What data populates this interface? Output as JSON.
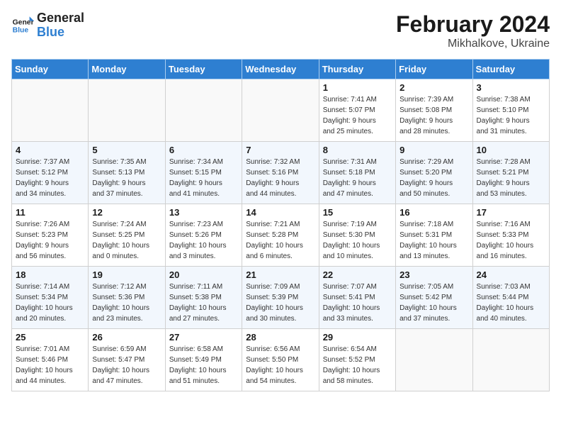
{
  "header": {
    "logo_line1": "General",
    "logo_line2": "Blue",
    "month_title": "February 2024",
    "subtitle": "Mikhalkove, Ukraine"
  },
  "columns": [
    "Sunday",
    "Monday",
    "Tuesday",
    "Wednesday",
    "Thursday",
    "Friday",
    "Saturday"
  ],
  "weeks": [
    [
      {
        "day": "",
        "info": ""
      },
      {
        "day": "",
        "info": ""
      },
      {
        "day": "",
        "info": ""
      },
      {
        "day": "",
        "info": ""
      },
      {
        "day": "1",
        "info": "Sunrise: 7:41 AM\nSunset: 5:07 PM\nDaylight: 9 hours\nand 25 minutes."
      },
      {
        "day": "2",
        "info": "Sunrise: 7:39 AM\nSunset: 5:08 PM\nDaylight: 9 hours\nand 28 minutes."
      },
      {
        "day": "3",
        "info": "Sunrise: 7:38 AM\nSunset: 5:10 PM\nDaylight: 9 hours\nand 31 minutes."
      }
    ],
    [
      {
        "day": "4",
        "info": "Sunrise: 7:37 AM\nSunset: 5:12 PM\nDaylight: 9 hours\nand 34 minutes."
      },
      {
        "day": "5",
        "info": "Sunrise: 7:35 AM\nSunset: 5:13 PM\nDaylight: 9 hours\nand 37 minutes."
      },
      {
        "day": "6",
        "info": "Sunrise: 7:34 AM\nSunset: 5:15 PM\nDaylight: 9 hours\nand 41 minutes."
      },
      {
        "day": "7",
        "info": "Sunrise: 7:32 AM\nSunset: 5:16 PM\nDaylight: 9 hours\nand 44 minutes."
      },
      {
        "day": "8",
        "info": "Sunrise: 7:31 AM\nSunset: 5:18 PM\nDaylight: 9 hours\nand 47 minutes."
      },
      {
        "day": "9",
        "info": "Sunrise: 7:29 AM\nSunset: 5:20 PM\nDaylight: 9 hours\nand 50 minutes."
      },
      {
        "day": "10",
        "info": "Sunrise: 7:28 AM\nSunset: 5:21 PM\nDaylight: 9 hours\nand 53 minutes."
      }
    ],
    [
      {
        "day": "11",
        "info": "Sunrise: 7:26 AM\nSunset: 5:23 PM\nDaylight: 9 hours\nand 56 minutes."
      },
      {
        "day": "12",
        "info": "Sunrise: 7:24 AM\nSunset: 5:25 PM\nDaylight: 10 hours\nand 0 minutes."
      },
      {
        "day": "13",
        "info": "Sunrise: 7:23 AM\nSunset: 5:26 PM\nDaylight: 10 hours\nand 3 minutes."
      },
      {
        "day": "14",
        "info": "Sunrise: 7:21 AM\nSunset: 5:28 PM\nDaylight: 10 hours\nand 6 minutes."
      },
      {
        "day": "15",
        "info": "Sunrise: 7:19 AM\nSunset: 5:30 PM\nDaylight: 10 hours\nand 10 minutes."
      },
      {
        "day": "16",
        "info": "Sunrise: 7:18 AM\nSunset: 5:31 PM\nDaylight: 10 hours\nand 13 minutes."
      },
      {
        "day": "17",
        "info": "Sunrise: 7:16 AM\nSunset: 5:33 PM\nDaylight: 10 hours\nand 16 minutes."
      }
    ],
    [
      {
        "day": "18",
        "info": "Sunrise: 7:14 AM\nSunset: 5:34 PM\nDaylight: 10 hours\nand 20 minutes."
      },
      {
        "day": "19",
        "info": "Sunrise: 7:12 AM\nSunset: 5:36 PM\nDaylight: 10 hours\nand 23 minutes."
      },
      {
        "day": "20",
        "info": "Sunrise: 7:11 AM\nSunset: 5:38 PM\nDaylight: 10 hours\nand 27 minutes."
      },
      {
        "day": "21",
        "info": "Sunrise: 7:09 AM\nSunset: 5:39 PM\nDaylight: 10 hours\nand 30 minutes."
      },
      {
        "day": "22",
        "info": "Sunrise: 7:07 AM\nSunset: 5:41 PM\nDaylight: 10 hours\nand 33 minutes."
      },
      {
        "day": "23",
        "info": "Sunrise: 7:05 AM\nSunset: 5:42 PM\nDaylight: 10 hours\nand 37 minutes."
      },
      {
        "day": "24",
        "info": "Sunrise: 7:03 AM\nSunset: 5:44 PM\nDaylight: 10 hours\nand 40 minutes."
      }
    ],
    [
      {
        "day": "25",
        "info": "Sunrise: 7:01 AM\nSunset: 5:46 PM\nDaylight: 10 hours\nand 44 minutes."
      },
      {
        "day": "26",
        "info": "Sunrise: 6:59 AM\nSunset: 5:47 PM\nDaylight: 10 hours\nand 47 minutes."
      },
      {
        "day": "27",
        "info": "Sunrise: 6:58 AM\nSunset: 5:49 PM\nDaylight: 10 hours\nand 51 minutes."
      },
      {
        "day": "28",
        "info": "Sunrise: 6:56 AM\nSunset: 5:50 PM\nDaylight: 10 hours\nand 54 minutes."
      },
      {
        "day": "29",
        "info": "Sunrise: 6:54 AM\nSunset: 5:52 PM\nDaylight: 10 hours\nand 58 minutes."
      },
      {
        "day": "",
        "info": ""
      },
      {
        "day": "",
        "info": ""
      }
    ]
  ]
}
